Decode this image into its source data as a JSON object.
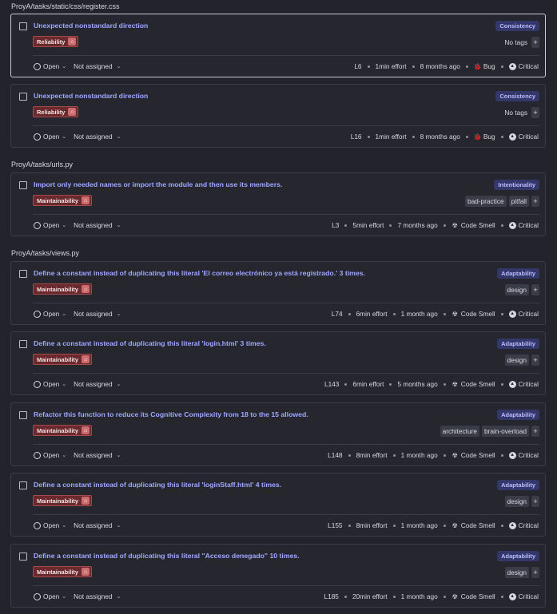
{
  "groups": [
    {
      "file": "ProyA/tasks/static/css/register.css",
      "issues": [
        {
          "title": "Unexpected nonstandard direction",
          "attribute": "Consistency",
          "quality": "Reliability",
          "tags": [],
          "no_tags": "No tags",
          "status": "Open",
          "assignee": "Not assigned",
          "line": "L6",
          "effort": "1min effort",
          "age": "8 months ago",
          "type": "Bug",
          "type_icon": "bug-icon",
          "severity": "Critical",
          "selected": true
        },
        {
          "title": "Unexpected nonstandard direction",
          "attribute": "Consistency",
          "quality": "Reliability",
          "tags": [],
          "no_tags": "No tags",
          "status": "Open",
          "assignee": "Not assigned",
          "line": "L16",
          "effort": "1min effort",
          "age": "8 months ago",
          "type": "Bug",
          "type_icon": "bug-icon",
          "severity": "Critical",
          "selected": false
        }
      ]
    },
    {
      "file": "ProyA/tasks/urls.py",
      "issues": [
        {
          "title": "Import only needed names or import the module and then use its members.",
          "attribute": "Intentionality",
          "quality": "Maintainability",
          "tags": [
            "bad-practice",
            "pitfall"
          ],
          "status": "Open",
          "assignee": "Not assigned",
          "line": "L3",
          "effort": "5min effort",
          "age": "7 months ago",
          "type": "Code Smell",
          "type_icon": "code-smell-icon",
          "severity": "Critical",
          "selected": false
        }
      ]
    },
    {
      "file": "ProyA/tasks/views.py",
      "issues": [
        {
          "title": "Define a constant instead of duplicating this literal 'El correo electrónico ya está registrado.' 3 times.",
          "attribute": "Adaptability",
          "quality": "Maintainability",
          "tags": [
            "design"
          ],
          "status": "Open",
          "assignee": "Not assigned",
          "line": "L74",
          "effort": "6min effort",
          "age": "1 month ago",
          "type": "Code Smell",
          "type_icon": "code-smell-icon",
          "severity": "Critical",
          "selected": false
        },
        {
          "title": "Define a constant instead of duplicating this literal 'login.html' 3 times.",
          "attribute": "Adaptability",
          "quality": "Maintainability",
          "tags": [
            "design"
          ],
          "status": "Open",
          "assignee": "Not assigned",
          "line": "L143",
          "effort": "6min effort",
          "age": "5 months ago",
          "type": "Code Smell",
          "type_icon": "code-smell-icon",
          "severity": "Critical",
          "selected": false
        },
        {
          "title": "Refactor this function to reduce its Cognitive Complexity from 18 to the 15 allowed.",
          "attribute": "Adaptability",
          "quality": "Maintainability",
          "tags": [
            "architecture",
            "brain-overload"
          ],
          "status": "Open",
          "assignee": "Not assigned",
          "line": "L148",
          "effort": "8min effort",
          "age": "1 month ago",
          "type": "Code Smell",
          "type_icon": "code-smell-icon",
          "severity": "Critical",
          "selected": false
        },
        {
          "title": "Define a constant instead of duplicating this literal 'loginStaff.html' 4 times.",
          "attribute": "Adaptability",
          "quality": "Maintainability",
          "tags": [
            "design"
          ],
          "status": "Open",
          "assignee": "Not assigned",
          "line": "L155",
          "effort": "8min effort",
          "age": "1 month ago",
          "type": "Code Smell",
          "type_icon": "code-smell-icon",
          "severity": "Critical",
          "selected": false
        },
        {
          "title": "Define a constant instead of duplicating this literal \"Acceso denegado\" 10 times.",
          "attribute": "Adaptability",
          "quality": "Maintainability",
          "tags": [
            "design"
          ],
          "status": "Open",
          "assignee": "Not assigned",
          "line": "L185",
          "effort": "20min effort",
          "age": "1 month ago",
          "type": "Code Smell",
          "type_icon": "code-smell-icon",
          "severity": "Critical",
          "selected": false
        }
      ]
    }
  ],
  "colors": {
    "title": "#9fa7ff",
    "quality_badge": "#6a2a2d",
    "attribute_badge": "#34376a",
    "background": "#22232b"
  }
}
